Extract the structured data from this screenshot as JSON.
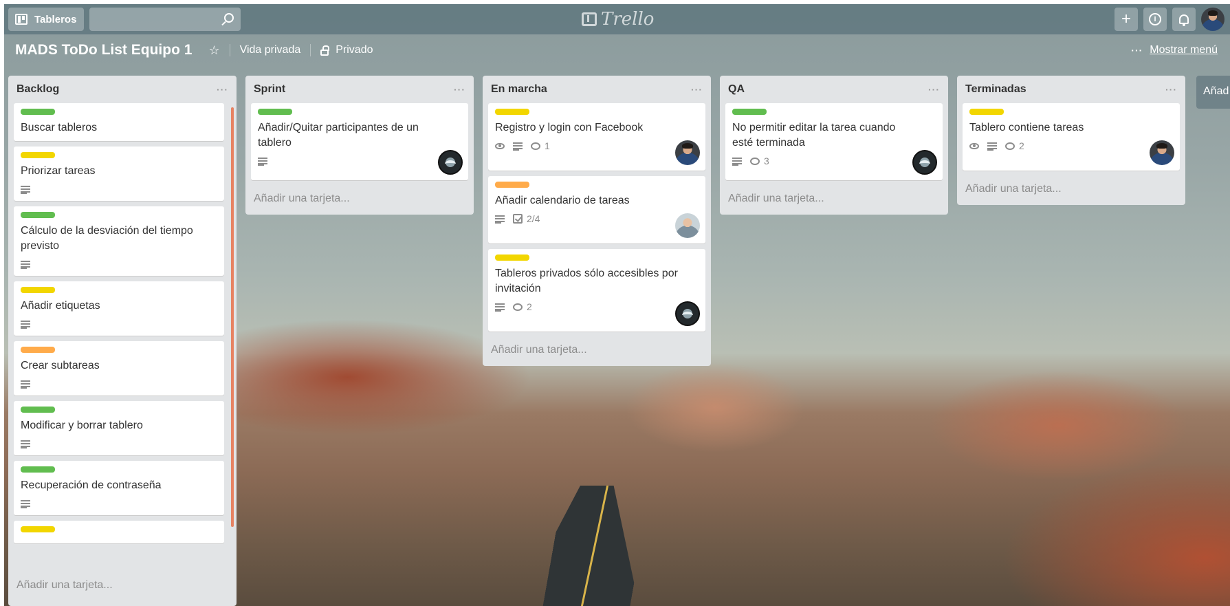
{
  "header": {
    "boards_label": "Tableros",
    "search_placeholder": "",
    "logo_text": "Trello",
    "add_symbol": "+",
    "info_symbol": "i"
  },
  "board": {
    "title": "MADS ToDo List Equipo 1",
    "star": "☆",
    "team": "Vida privada",
    "visibility": "Privado",
    "menu_dots": "···",
    "menu_label": "Mostrar menú"
  },
  "colors": {
    "green": "#61bd4f",
    "yellow": "#f2d600",
    "orange": "#ffab4a"
  },
  "lists": [
    {
      "title": "Backlog",
      "menu": "···",
      "add_card": "Añadir una tarjeta...",
      "cards": [
        {
          "label": "green",
          "title": "Buscar tableros",
          "description": false
        },
        {
          "label": "yellow",
          "title": "Priorizar tareas",
          "description": true
        },
        {
          "label": "green",
          "title": "Cálculo de la desviación del tiempo previsto",
          "description": true
        },
        {
          "label": "yellow",
          "title": "Añadir etiquetas",
          "description": true
        },
        {
          "label": "orange",
          "title": "Crear subtareas",
          "description": true
        },
        {
          "label": "green",
          "title": "Modificar y borrar tablero",
          "description": true
        },
        {
          "label": "green",
          "title": "Recuperación de contraseña",
          "description": true
        },
        {
          "label": "yellow",
          "title": "",
          "description": false
        }
      ]
    },
    {
      "title": "Sprint",
      "menu": "···",
      "add_card": "Añadir una tarjeta...",
      "cards": [
        {
          "label": "green",
          "title": "Añadir/Quitar participantes de un tablero",
          "description": true,
          "avatar": "logo-av"
        }
      ]
    },
    {
      "title": "En marcha",
      "menu": "···",
      "add_card": "Añadir una tarjeta...",
      "cards": [
        {
          "label": "yellow",
          "title": "Registro y login con Facebook",
          "watch": true,
          "description": true,
          "comments": "1",
          "avatar": "face"
        },
        {
          "label": "orange",
          "title": "Añadir calendario de tareas",
          "description": true,
          "checklist": "2/4",
          "avatar": "light"
        },
        {
          "label": "yellow",
          "title": "Tableros privados sólo accesibles por invitación",
          "description": true,
          "comments": "2",
          "avatar": "logo-av"
        }
      ]
    },
    {
      "title": "QA",
      "menu": "···",
      "add_card": "Añadir una tarjeta...",
      "cards": [
        {
          "label": "green",
          "title": "No permitir editar la tarea cuando esté terminada",
          "description": true,
          "comments": "3",
          "avatar": "logo-av"
        }
      ]
    },
    {
      "title": "Terminadas",
      "menu": "···",
      "add_card": "Añadir una tarjeta...",
      "cards": [
        {
          "label": "yellow",
          "title": "Tablero contiene tareas",
          "watch": true,
          "description": true,
          "comments": "2",
          "avatar": "face"
        }
      ]
    }
  ],
  "add_list_partial": "Añad"
}
